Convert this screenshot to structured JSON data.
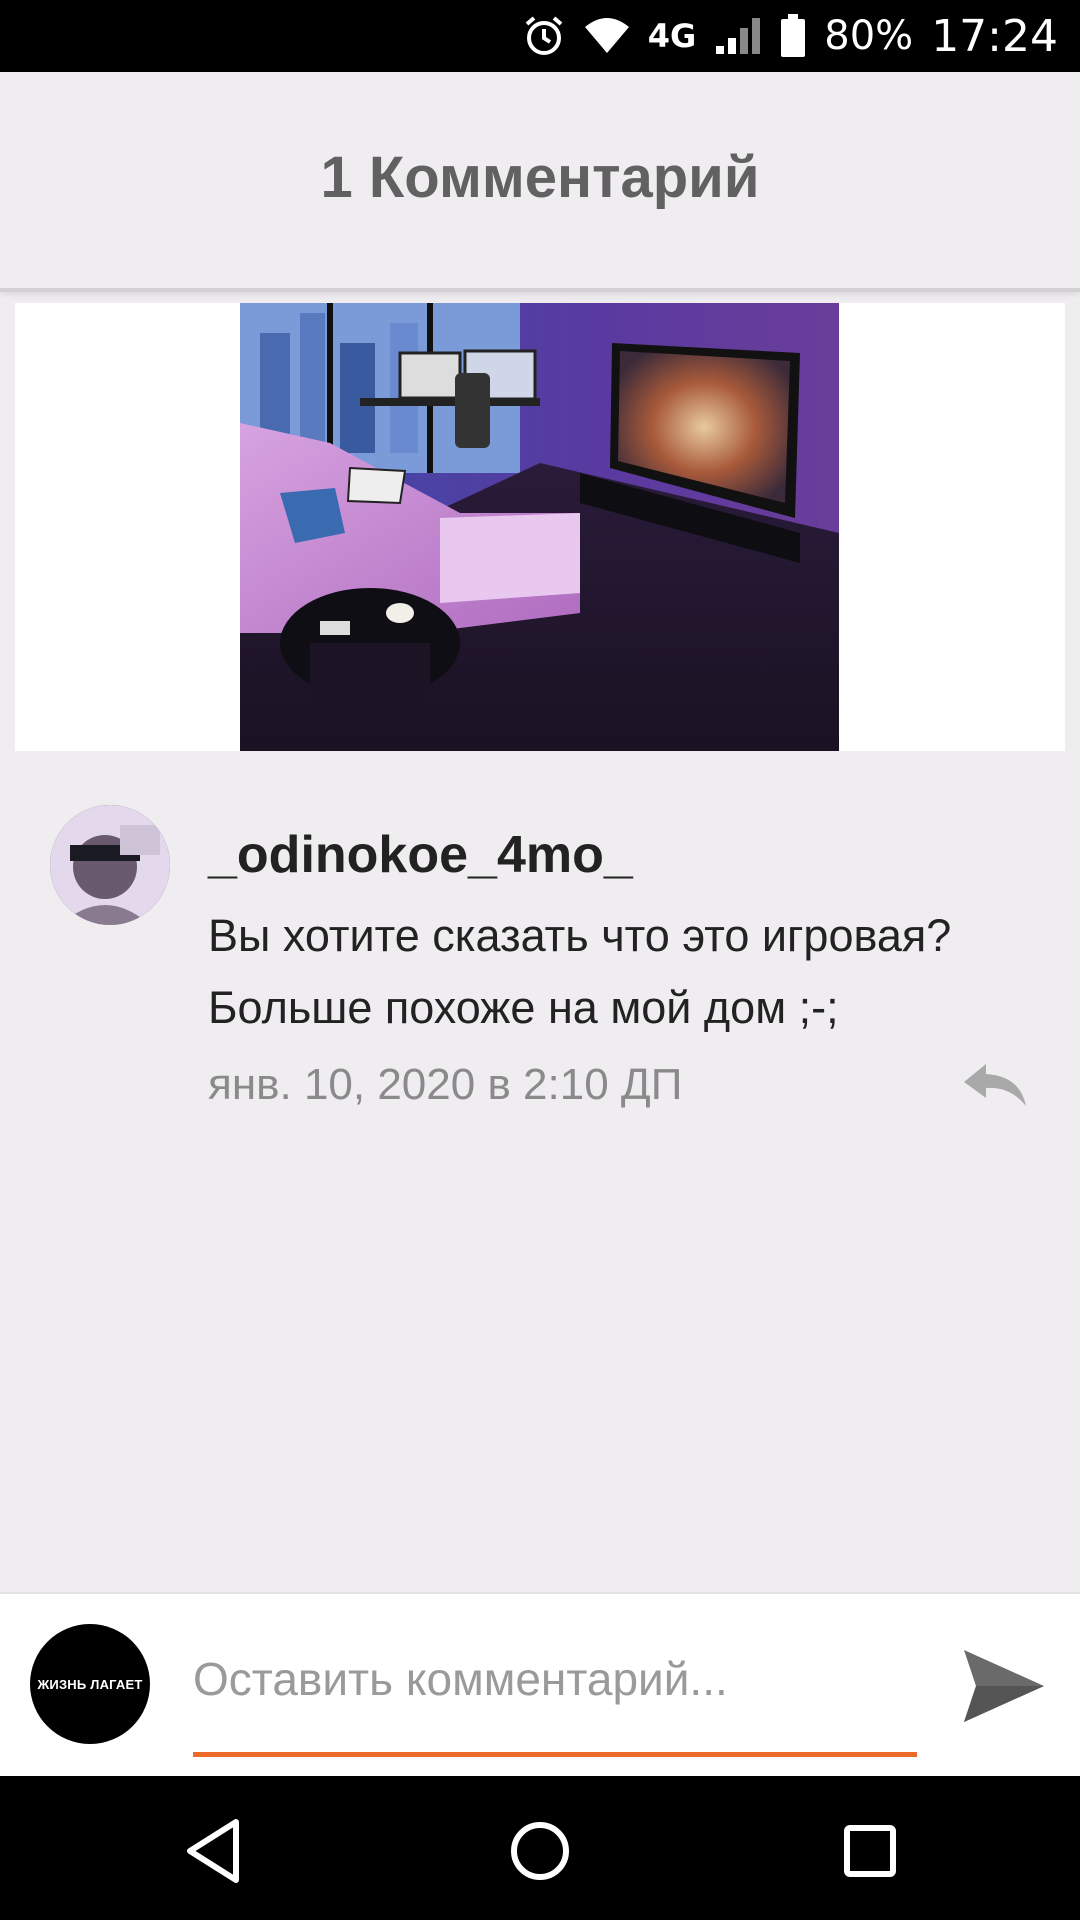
{
  "status_bar": {
    "network": "4G",
    "battery": "80%",
    "time": "17:24",
    "icons": [
      "alarm-icon",
      "wifi-icon",
      "signal-icon",
      "battery-icon"
    ]
  },
  "header": {
    "title": "1 Комментарий"
  },
  "comment": {
    "username": "_odinokoe_4mo_",
    "text_line1": "Вы хотите сказать что это игровая?",
    "text_line2": "Больше похоже на мой дом ;-;",
    "date": "янв. 10, 2020 в 2:10 ДП"
  },
  "input_bar": {
    "avatar_text": "ЖИЗНЬ ЛАГАЕТ",
    "placeholder": "Оставить комментарий...",
    "accent": "#ec6b2a"
  },
  "nav": {
    "icons": [
      "back-icon",
      "home-icon",
      "recents-icon"
    ]
  }
}
